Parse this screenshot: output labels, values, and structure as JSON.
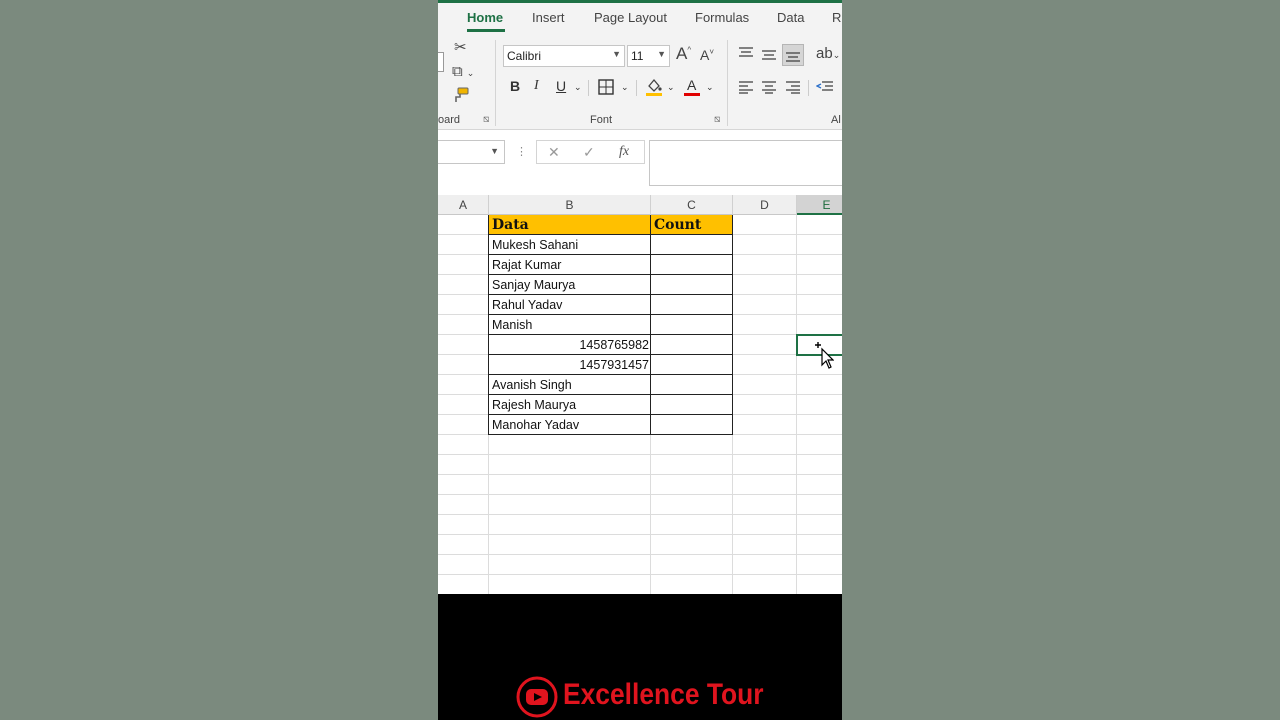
{
  "ribbon": {
    "tabs": [
      {
        "label": "Home",
        "active": true
      },
      {
        "label": "Insert",
        "active": false
      },
      {
        "label": "Page Layout",
        "active": false
      },
      {
        "label": "Formulas",
        "active": false
      },
      {
        "label": "Data",
        "active": false
      },
      {
        "label": "R",
        "active": false
      }
    ],
    "groups": {
      "clipboard_label": "oard",
      "font_label": "Font",
      "alignment_label": "Al"
    },
    "font_name": "Calibri",
    "font_size": "11",
    "font_grow": "A",
    "font_shrink": "A",
    "bold": "B",
    "italic": "I",
    "underline": "U",
    "font_color_letter": "A",
    "accent_color": "#1e7145",
    "highlight_color": "#ffc000",
    "font_color": "#e00000"
  },
  "formula_bar": {
    "name_box": "",
    "cancel": "✕",
    "enter": "✓",
    "fx": "fx",
    "formula": ""
  },
  "sheet": {
    "columns": [
      "A",
      "B",
      "C",
      "D",
      "E"
    ],
    "selected_column": "E",
    "header_row": {
      "data": "Data",
      "count": "Count"
    },
    "header_fill": "#ffc000",
    "rows": [
      {
        "value": "Mukesh Sahani",
        "numeric": false
      },
      {
        "value": "Rajat Kumar",
        "numeric": false
      },
      {
        "value": "Sanjay Maurya",
        "numeric": false
      },
      {
        "value": "Rahul Yadav",
        "numeric": false
      },
      {
        "value": "Manish",
        "numeric": false
      },
      {
        "value": "1458765982",
        "numeric": true
      },
      {
        "value": "1457931457",
        "numeric": true
      },
      {
        "value": "Avanish Singh",
        "numeric": false
      },
      {
        "value": "Rajesh Maurya",
        "numeric": false
      },
      {
        "value": "Manohar Yadav",
        "numeric": false
      }
    ]
  },
  "branding": {
    "channel_name": "Excellence Tour",
    "brand_color": "#e0141e"
  }
}
